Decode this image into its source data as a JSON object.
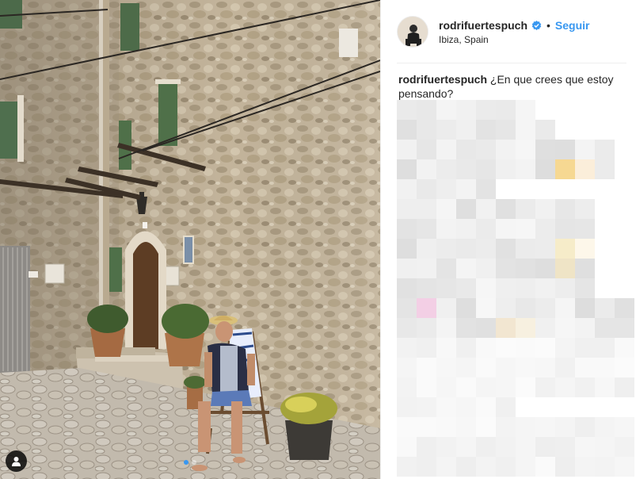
{
  "post": {
    "username": "rodrifuertespuch",
    "bullet": "•",
    "follow_label": "Seguir",
    "location": "Ibiza, Spain",
    "caption_user": "rodrifuertespuch",
    "caption_text": " ¿En que crees que estoy pensando?"
  },
  "photo": {
    "icons": {
      "user_tag": "person-tag-icon",
      "verified": "verified-badge-icon"
    },
    "carousel": {
      "count": 2,
      "active_index": 0
    }
  },
  "colors": {
    "accent": "#3897f0",
    "text": "#262626",
    "divider": "#efefef"
  }
}
